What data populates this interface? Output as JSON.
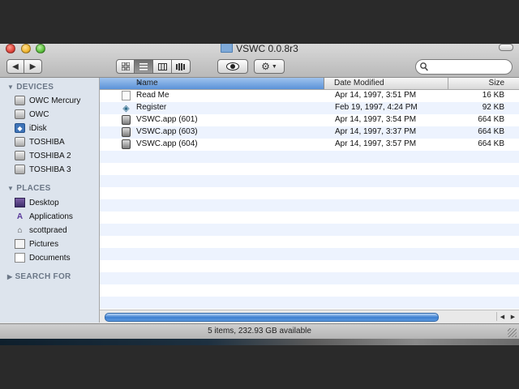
{
  "window": {
    "title": "VSWC 0.0.8r3",
    "title_icon": "folder-icon"
  },
  "toolbar": {
    "back_icon": "◀",
    "forward_icon": "▶",
    "view_icons": [
      "icon-view",
      "list-view",
      "column-view",
      "coverflow-view"
    ],
    "selected_view": "list-view",
    "quicklook_icon": "eye-icon",
    "action_icon": "gear-icon",
    "search_placeholder": ""
  },
  "sidebar": {
    "sections": [
      {
        "title": "DEVICES",
        "expanded": true,
        "items": [
          {
            "label": "OWC Mercury",
            "icon": "drive-icon"
          },
          {
            "label": "OWC",
            "icon": "drive-icon"
          },
          {
            "label": "iDisk",
            "icon": "idisk-icon"
          },
          {
            "label": "TOSHIBA",
            "icon": "drive-icon"
          },
          {
            "label": "TOSHIBA 2",
            "icon": "drive-icon"
          },
          {
            "label": "TOSHIBA 3",
            "icon": "drive-icon"
          }
        ]
      },
      {
        "title": "PLACES",
        "expanded": true,
        "items": [
          {
            "label": "Desktop",
            "icon": "desktop-icon"
          },
          {
            "label": "Applications",
            "icon": "applications-icon"
          },
          {
            "label": "scottpraed",
            "icon": "home-icon"
          },
          {
            "label": "Pictures",
            "icon": "pictures-icon"
          },
          {
            "label": "Documents",
            "icon": "documents-icon"
          }
        ]
      },
      {
        "title": "SEARCH FOR",
        "expanded": false,
        "items": []
      }
    ]
  },
  "list": {
    "columns": {
      "name": "Name",
      "date": "Date Modified",
      "size": "Size"
    },
    "sort_column": "Name",
    "sort_direction": "ascending",
    "rows": [
      {
        "name": "Read Me",
        "date": "Apr 14, 1997, 3:51 PM",
        "size": "16 KB",
        "icon": "document-icon"
      },
      {
        "name": "Register",
        "date": "Feb 19, 1997, 4:24 PM",
        "size": "92 KB",
        "icon": "register-app-icon"
      },
      {
        "name": "VSWC.app (601)",
        "date": "Apr 14, 1997, 3:54 PM",
        "size": "664 KB",
        "icon": "app-icon"
      },
      {
        "name": "VSWC.app (603)",
        "date": "Apr 14, 1997, 3:37 PM",
        "size": "664 KB",
        "icon": "app-icon"
      },
      {
        "name": "VSWC.app (604)",
        "date": "Apr 14, 1997, 3:57 PM",
        "size": "664 KB",
        "icon": "app-icon"
      }
    ]
  },
  "status": {
    "text": "5 items, 232.93 GB available"
  },
  "colors": {
    "header_selected": "#5b92d8",
    "sidebar_bg": "#dde4ed",
    "row_alt": "#edf3fe"
  }
}
